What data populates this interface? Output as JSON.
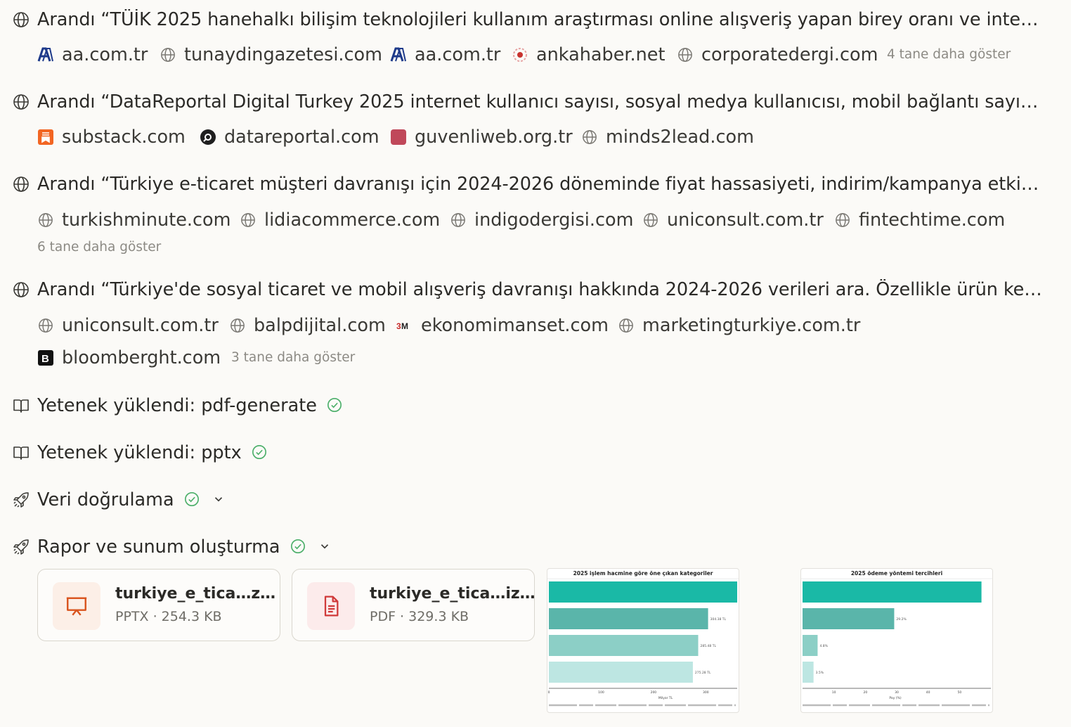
{
  "searches": [
    {
      "query": "Arandı “TÜİK 2025 hanehalkı bilişim teknolojileri kullanım araştırması online alışveriş yapan birey oranı ve internet…",
      "sources": [
        "aa.com.tr",
        "tunaydingazetesi.com",
        "aa.com.tr",
        "ankahaber.net",
        "corporatedergi.com"
      ],
      "more": "4 tane daha göster"
    },
    {
      "query": "Arandı “DataReportal Digital Turkey 2025 internet kullanıcı sayısı, sosyal medya kullanıcısı, mobil bağlantı sayısı …",
      "sources": [
        "substack.com",
        "datareportal.com",
        "guvenliweb.org.tr",
        "minds2lead.com"
      ],
      "more": ""
    },
    {
      "query": "Arandı “Türkiye e-ticaret müşteri davranışı için 2024-2026 döneminde fiyat hassasiyeti, indirim/kampanya etkisi, …",
      "sources": [
        "turkishminute.com",
        "lidiacommerce.com",
        "indigodergisi.com",
        "uniconsult.com.tr",
        "fintechtime.com"
      ],
      "more": "6 tane daha göster"
    },
    {
      "query": "Arandı “Türkiye'de sosyal ticaret ve mobil alışveriş davranışı hakkında 2024-2026 verileri ara. Özellikle ürün keşfi…",
      "sources": [
        "uniconsult.com.tr",
        "balpdijital.com",
        "ekonomimanset.com",
        "marketingturkiye.com.tr",
        "bloomberght.com"
      ],
      "more": "3 tane daha göster"
    }
  ],
  "steps": [
    {
      "label": "Yetenek yüklendi: pdf-generate",
      "icon": "book-icon"
    },
    {
      "label": "Yetenek yüklendi: pptx",
      "icon": "book-icon"
    },
    {
      "label": "Veri doğrulama",
      "icon": "rocket-icon"
    },
    {
      "label": "Rapor ve sunum oluşturma",
      "icon": "rocket-icon"
    }
  ],
  "files": [
    {
      "name": "turkiye_e_tica…z…",
      "meta": "PPTX · 254.3 KB",
      "icon": "presentation-icon",
      "color": "#d9541e"
    },
    {
      "name": "turkiye_e_tica…iz…",
      "meta": "PDF · 329.3 KB",
      "icon": "document-icon",
      "color": "#d03a3a"
    }
  ],
  "colors": {
    "accent_green": "#4caf6a",
    "teal": "#1ab9a6",
    "text": "#2b2a27",
    "muted": "#8c8a84"
  },
  "chart_data": [
    {
      "type": "bar",
      "title": "2025 işlem hacmine göre öne çıkan kategoriler",
      "orientation": "horizontal",
      "categories": [
        "",
        "",
        "",
        ""
      ],
      "values": [
        360,
        304.38,
        285.48,
        275.28
      ],
      "data_labels": [
        "",
        "304.38 TL",
        "285.48 TL",
        "275.28 TL"
      ],
      "xlabel": "Milyar TL",
      "xticks": [
        "0",
        "100",
        "200",
        "300"
      ],
      "xlim": [
        0,
        360
      ]
    },
    {
      "type": "bar",
      "title": "2025 ödeme yöntemi tercihleri",
      "orientation": "horizontal",
      "categories": [
        "",
        "",
        "",
        ""
      ],
      "values": [
        57,
        29.2,
        4.8,
        3.5
      ],
      "data_labels": [
        "",
        "29.2%",
        "4.8%",
        "3.5%"
      ],
      "xlabel": "Pay (%)",
      "xticks": [
        "10",
        "20",
        "30",
        "40",
        "50"
      ],
      "xlim": [
        0,
        60
      ]
    }
  ]
}
